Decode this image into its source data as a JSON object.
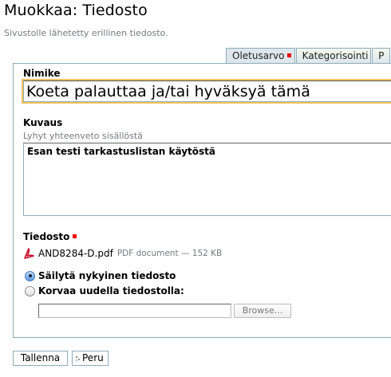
{
  "page": {
    "title": "Muokkaa: Tiedosto",
    "description": "Sivustolle lähetetty erillinen tiedosto."
  },
  "tabs": [
    {
      "label": "Oletusarvo",
      "selected": true,
      "required": true
    },
    {
      "label": "Kategorisointi",
      "selected": false,
      "required": false
    },
    {
      "label": "P",
      "selected": false,
      "required": false
    }
  ],
  "fields": {
    "title_label": "Nimike",
    "title_value": "Koeta palauttaa ja/tai hyväksyä tämä",
    "description_label": "Kuvaus",
    "description_help": "Lyhyt yhteenveto sisällöstä",
    "description_value": "Esan testi tarkastuslistan käytöstä",
    "file_label": "Tiedosto",
    "file_name": "AND8284-D.pdf",
    "file_meta": "PDF document — 152 KB",
    "keep_option": "Säilytä nykyinen tiedosto",
    "replace_option": "Korvaa uudella tiedostolla:",
    "browse_label": "Browse..."
  },
  "buttons": {
    "save": "Tallenna",
    "cancel": "Peru"
  },
  "colors": {
    "required_marker": "#ee0000",
    "border": "#8cacbb",
    "focus": "#f2c25b"
  },
  "icons": {
    "file": "pdf-icon",
    "cancel": "cancel-icon"
  }
}
